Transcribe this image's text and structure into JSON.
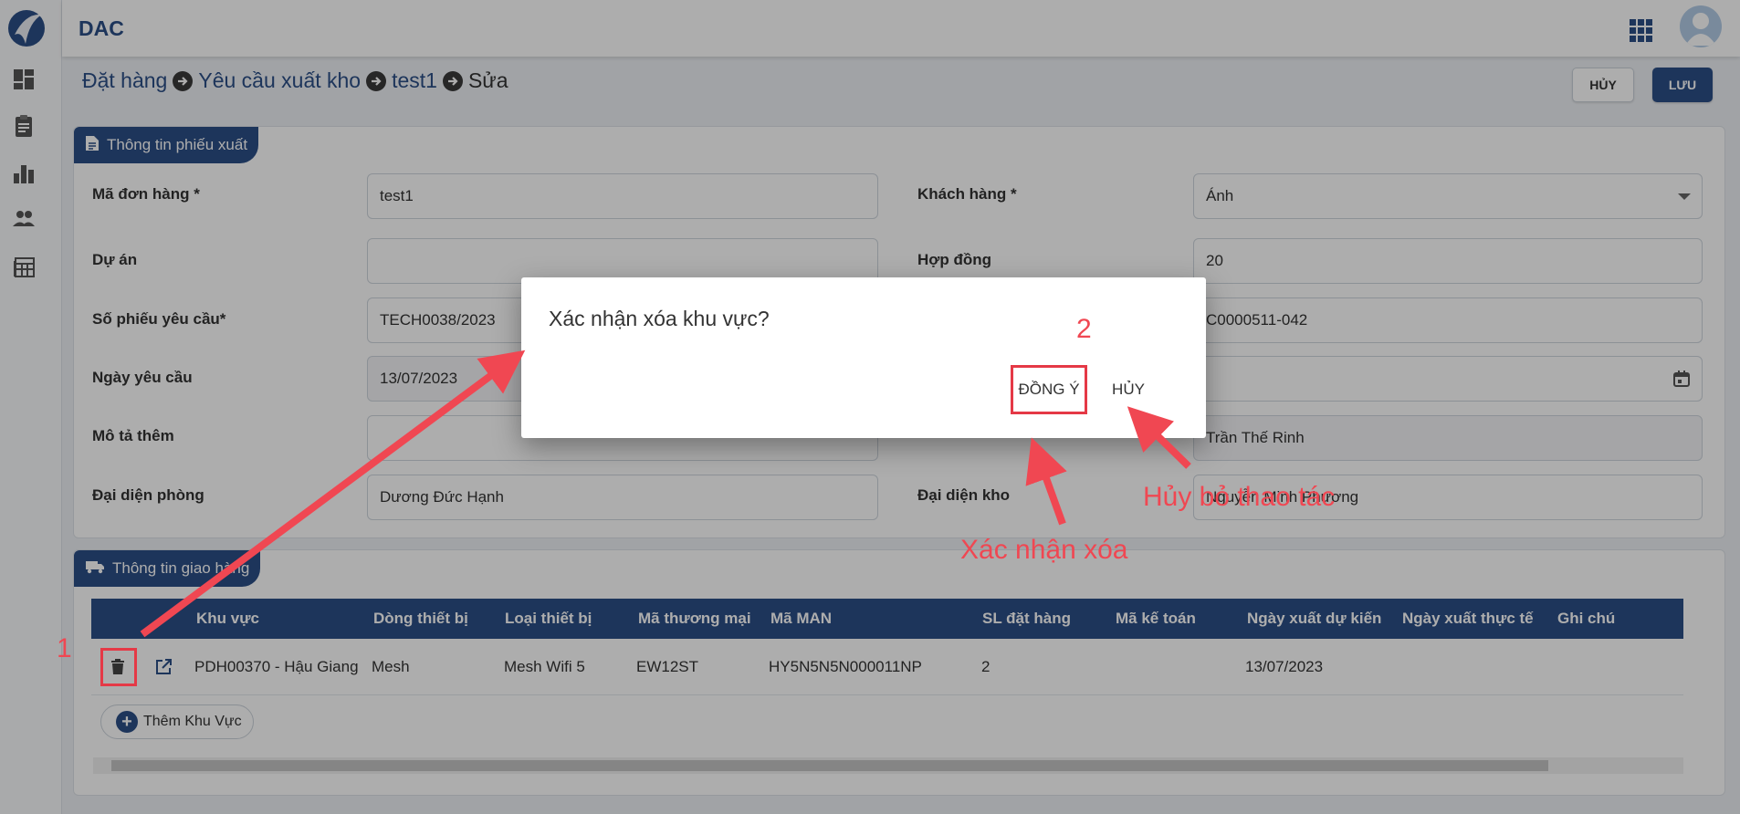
{
  "app": {
    "title": "DAC"
  },
  "breadcrumb": [
    "Đặt hàng",
    "Yêu cầu xuất kho",
    "test1",
    "Sửa"
  ],
  "toolbar": {
    "cancel_label": "HỦY",
    "save_label": "LƯU"
  },
  "sections": {
    "export_info": "Thông tin phiếu xuất",
    "delivery_info": "Thông tin giao hàng"
  },
  "form": {
    "order_code": {
      "label": "Mã đơn hàng *",
      "value": "test1"
    },
    "customer": {
      "label": "Khách hàng *",
      "value": "Ánh"
    },
    "project": {
      "label": "Dự án",
      "value": ""
    },
    "contract": {
      "label": "Hợp đồng",
      "value": "20"
    },
    "request_no": {
      "label": "Số phiếu yêu cầu*",
      "value": "TECH0038/2023"
    },
    "right_row3_value": "C0000511-042",
    "request_date": {
      "label": "Ngày yêu cầu",
      "value": "13/07/2023"
    },
    "description": {
      "label": "Mô tả thêm",
      "value": ""
    },
    "creator_value": "Trần Thế Rinh",
    "dept_rep": {
      "label": "Đại diện phòng",
      "value": "Dương Đức Hạnh"
    },
    "warehouse_rep": {
      "label": "Đại diện kho",
      "value": "Nguyễn Minh Phương"
    }
  },
  "table": {
    "headers": [
      "Khu vực",
      "Dòng thiết bị",
      "Loại thiết bị",
      "Mã thương mại",
      "Mã MAN",
      "SL đặt hàng",
      "Mã kế toán",
      "Ngày xuất dự kiến",
      "Ngày xuất thực tế",
      "Ghi chú"
    ],
    "rows": [
      [
        "PDH00370 - Hậu Giang",
        "Mesh",
        "Mesh Wifi 5",
        "EW12ST",
        "HY5N5N5N000011NP",
        "2",
        "",
        "13/07/2023",
        "",
        ""
      ]
    ],
    "add_area_label": "Thêm Khu Vực"
  },
  "dialog": {
    "message": "Xác nhận xóa khu vực?",
    "confirm_label": "ĐỒNG Ý",
    "cancel_label": "HỦY"
  },
  "annotations": {
    "step1": "1",
    "step2": "2",
    "confirm_delete": "Xác nhận xóa",
    "cancel_action": "Hủy bỏ thao tác"
  },
  "colors": {
    "primary": "#2b4e86",
    "annotation_red": "#f04752"
  }
}
